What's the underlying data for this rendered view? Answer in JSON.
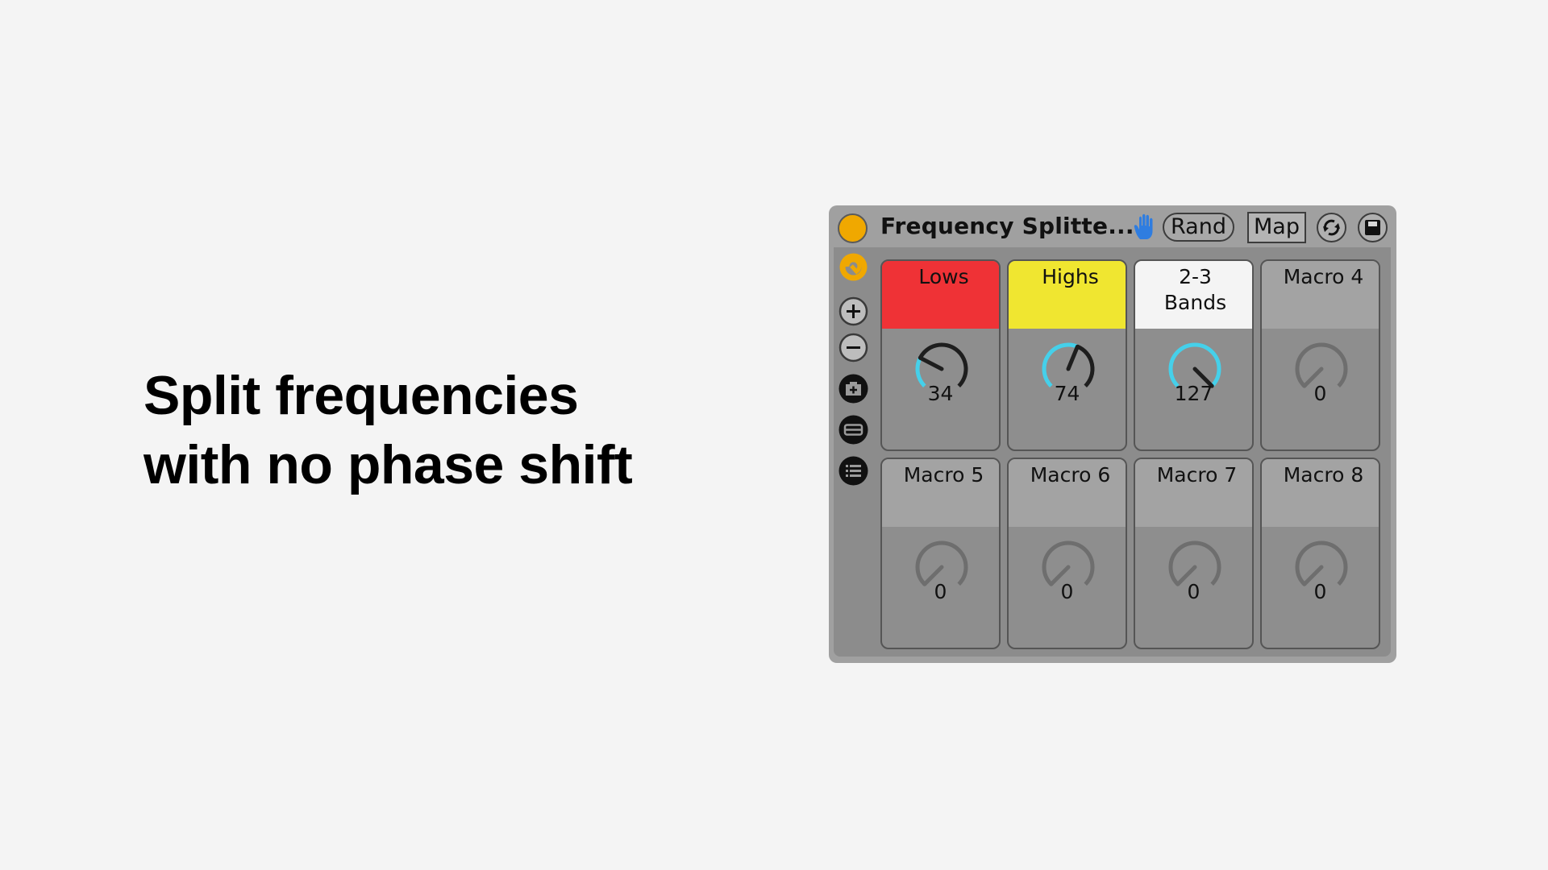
{
  "headline": {
    "line1": "Split frequencies",
    "line2": "with no phase shift"
  },
  "device": {
    "title": "Frequency Splitte...",
    "power_on": true,
    "rand_label": "Rand",
    "map_label": "Map",
    "icons": {
      "power": "power-toggle-icon",
      "hand": "hand-icon",
      "refresh": "refresh-icon",
      "save": "save-icon"
    },
    "sidebar": [
      {
        "name": "hot-swap-icon",
        "kind": "orange-ring"
      },
      {
        "name": "add-macro-icon",
        "kind": "plus"
      },
      {
        "name": "remove-macro-icon",
        "kind": "minus"
      },
      {
        "name": "add-variation-icon",
        "kind": "camera-plus"
      },
      {
        "name": "show-chain-icon",
        "kind": "bar"
      },
      {
        "name": "chain-list-icon",
        "kind": "list"
      }
    ],
    "colors": {
      "power": "#f0a800",
      "hand": "#2f7de0",
      "knob_active": "#45d0ea",
      "knob_track": "#1e1e1e",
      "knob_inactive": "#6e6e6e"
    },
    "macros": [
      {
        "label": "Lows",
        "value": 34,
        "max": 127,
        "color": "#ef3236",
        "active": true
      },
      {
        "label": "Highs",
        "value": 74,
        "max": 127,
        "color": "#f0e630",
        "active": true
      },
      {
        "label": "2-3 Bands",
        "value": 127,
        "max": 127,
        "color": "#f4f4f4",
        "active": true
      },
      {
        "label": "Macro 4",
        "value": 0,
        "max": 127,
        "color": null,
        "active": false
      },
      {
        "label": "Macro 5",
        "value": 0,
        "max": 127,
        "color": null,
        "active": false
      },
      {
        "label": "Macro 6",
        "value": 0,
        "max": 127,
        "color": null,
        "active": false
      },
      {
        "label": "Macro 7",
        "value": 0,
        "max": 127,
        "color": null,
        "active": false
      },
      {
        "label": "Macro 8",
        "value": 0,
        "max": 127,
        "color": null,
        "active": false
      }
    ]
  }
}
